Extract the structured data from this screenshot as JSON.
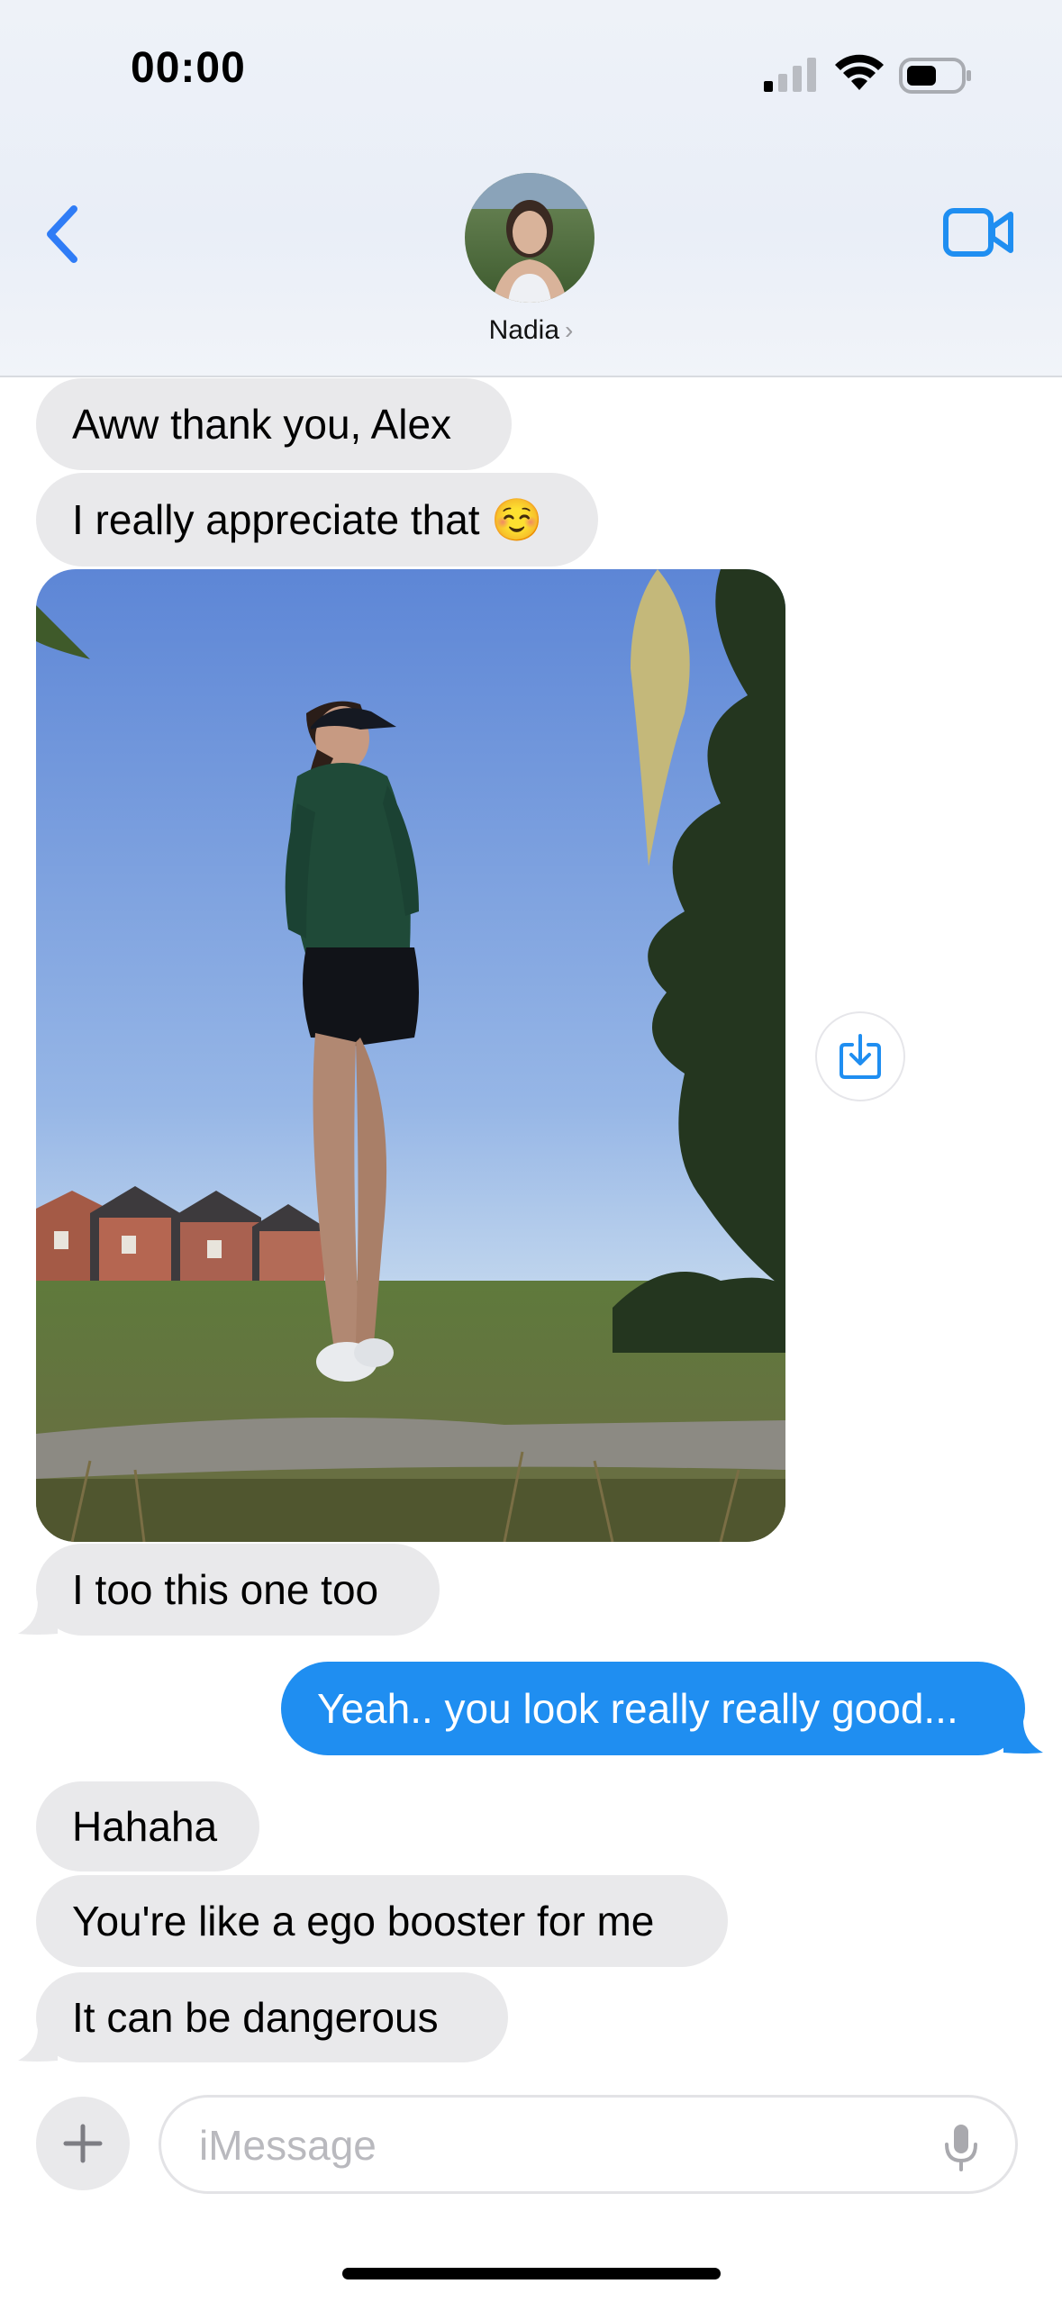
{
  "status_bar": {
    "time": "00:00",
    "icons": [
      "signal-icon",
      "wifi-icon",
      "battery-icon"
    ]
  },
  "header": {
    "back_icon": "chevron-left-icon",
    "contact_name": "Nadia",
    "contact_chevron": "›",
    "video_icon": "video-camera-icon"
  },
  "messages": [
    {
      "from": "contact",
      "text": "Aww thank you, Alex"
    },
    {
      "from": "contact",
      "text": "I really appreciate that ☺️"
    },
    {
      "from": "contact",
      "type": "photo"
    },
    {
      "from": "contact",
      "text": "I too this one too"
    },
    {
      "from": "me",
      "text": "Yeah.. you look really really good..."
    },
    {
      "from": "contact",
      "text": "Hahaha"
    },
    {
      "from": "contact",
      "text": "You're like a ego booster for me"
    },
    {
      "from": "contact",
      "text": "It can be dangerous"
    }
  ],
  "photo_actions": {
    "save_icon": "save-download-icon"
  },
  "composer": {
    "plus_icon": "plus-icon",
    "placeholder": "iMessage",
    "mic_icon": "microphone-icon"
  },
  "colors": {
    "accent": "#1f8ef1",
    "received_bubble": "#e9e9eb",
    "header_bg": "#eef2f8"
  }
}
